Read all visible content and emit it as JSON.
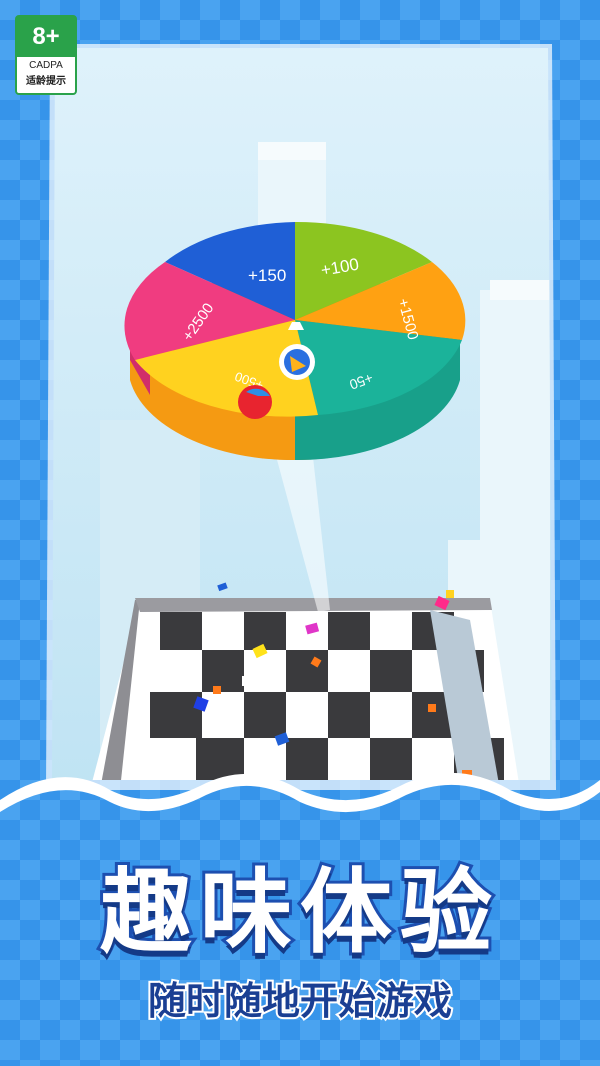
{
  "rating": {
    "age": "8+",
    "org": "CADPA",
    "tip": "适龄提示"
  },
  "wheel": {
    "segments": [
      {
        "label": "+150",
        "color": "#1f5fd6"
      },
      {
        "label": "+100",
        "color": "#8cc520"
      },
      {
        "label": "+1500",
        "color": "#ffa112"
      },
      {
        "label": "+50",
        "color": "#1bb39a"
      },
      {
        "label": "+2500",
        "color": "#f03c80"
      },
      {
        "label": "+500",
        "color": "#ffd21f"
      }
    ]
  },
  "promo": {
    "title": "趣味体验",
    "subtitle": "随时随地开始游戏"
  },
  "colors": {
    "sky": "#c4e6f4",
    "frame": "#e9f6fd",
    "brand_blue": "#1d4fb0"
  }
}
